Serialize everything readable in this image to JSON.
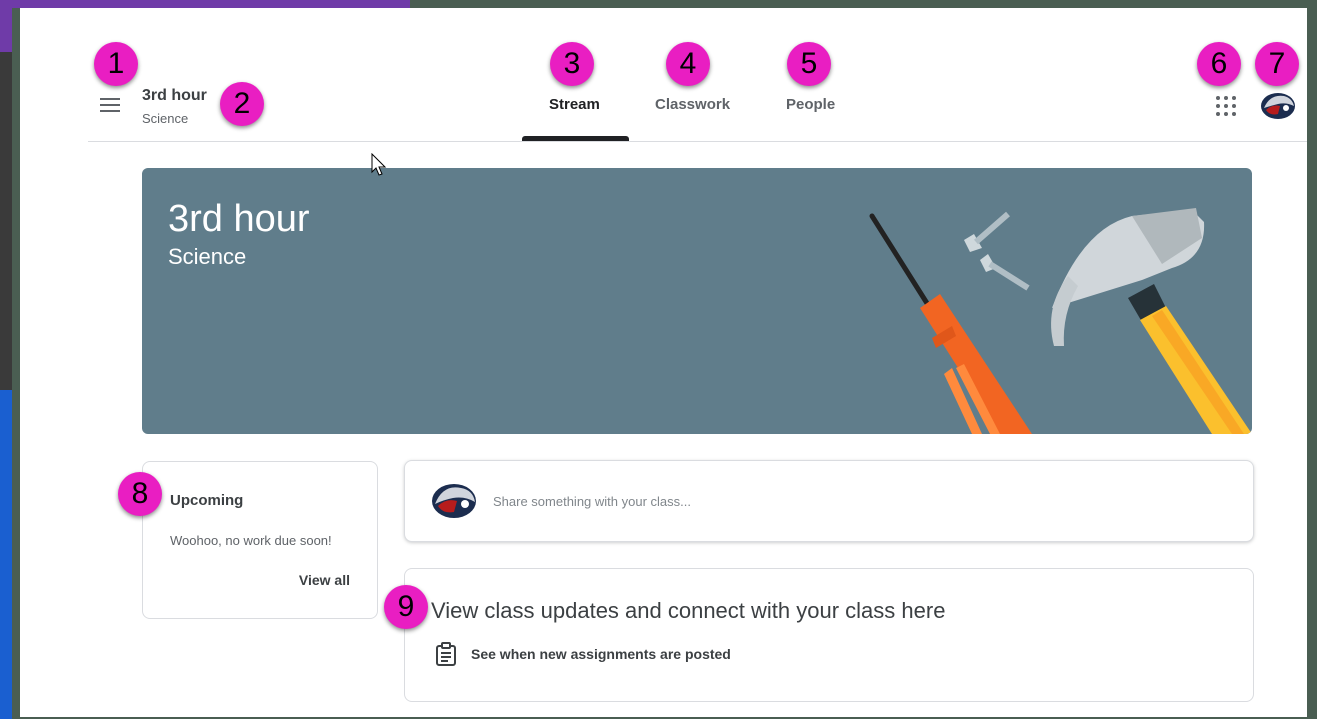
{
  "header": {
    "class_title": "3rd hour",
    "class_subtitle": "Science",
    "tabs": [
      {
        "label": "Stream",
        "active": true
      },
      {
        "label": "Classwork",
        "active": false
      },
      {
        "label": "People",
        "active": false
      }
    ]
  },
  "banner": {
    "title": "3rd hour",
    "subtitle": "Science",
    "color": "#607d8b"
  },
  "upcoming": {
    "title": "Upcoming",
    "empty_text": "Woohoo, no work due soon!",
    "view_all": "View all"
  },
  "share": {
    "placeholder": "Share something with your class..."
  },
  "updates": {
    "title": "View class updates and connect with your class here",
    "item": "See when new assignments are posted"
  },
  "callouts": [
    "1",
    "2",
    "3",
    "4",
    "5",
    "6",
    "7",
    "8",
    "9"
  ],
  "colors": {
    "callout": "#e91ec2",
    "banner": "#607d8b",
    "active_tab": "#202124"
  }
}
